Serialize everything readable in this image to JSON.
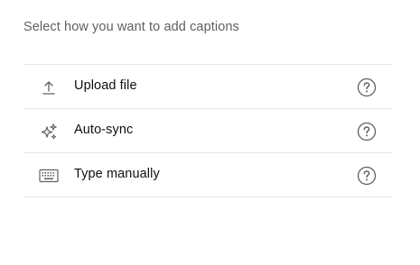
{
  "dialog": {
    "subtitle": "Select how you want to add captions"
  },
  "options": [
    {
      "label": "Upload file",
      "icon": "upload-icon",
      "help_icon": "help-icon"
    },
    {
      "label": "Auto-sync",
      "icon": "sparkle-icon",
      "help_icon": "help-icon"
    },
    {
      "label": "Type manually",
      "icon": "keyboard-icon",
      "help_icon": "help-icon"
    }
  ],
  "colors": {
    "text_primary": "#0f0f0f",
    "text_secondary": "#606060",
    "divider": "#e5e5e5",
    "icon": "#606060"
  }
}
